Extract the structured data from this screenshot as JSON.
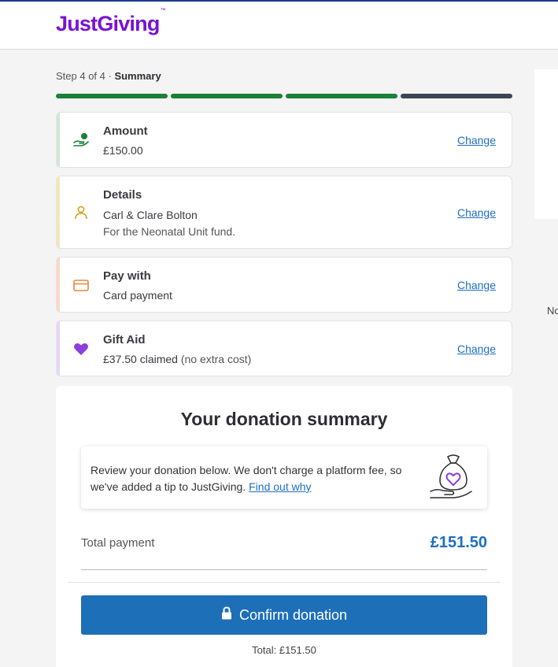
{
  "header": {
    "brand": "JustGiving",
    "trademark": "™"
  },
  "step": {
    "prefix": "Step 4 of 4 · ",
    "current": "Summary",
    "total_steps": 4,
    "completed_steps": 3
  },
  "colors": {
    "brand": "#7a12d4",
    "progress_done": "#1b8038",
    "progress_todo": "#3f4456",
    "link": "#1e6fc0",
    "button": "#1d6fb8"
  },
  "sections": [
    {
      "title": "Amount",
      "lines": [
        "£150.00"
      ],
      "change": "Change",
      "icon": "hand-coin-icon",
      "accent": "#cfe8d6"
    },
    {
      "title": "Details",
      "lines": [
        "Carl & Clare Bolton",
        "For the Neonatal Unit fund."
      ],
      "change": "Change",
      "icon": "person-icon",
      "accent": "#f5e6b8"
    },
    {
      "title": "Pay with",
      "lines": [
        "Card payment"
      ],
      "change": "Change",
      "icon": "card-icon",
      "accent": "#fbd9c4"
    },
    {
      "title": "Gift Aid",
      "amount": "£37.50 claimed",
      "note": " (no extra cost)",
      "change": "Change",
      "icon": "heart-icon",
      "accent": "#e6d7f7"
    }
  ],
  "side": {
    "text": "No"
  },
  "summary": {
    "heading": "Your donation summary",
    "review_text": "Review your donation below. We don't charge a platform fee, so we've added a tip to JustGiving.",
    "review_link": "Find out why",
    "total_label": "Total payment",
    "total_value": "£151.50",
    "confirm_label": "Confirm donation",
    "footer_total": "Total: £151.50"
  }
}
